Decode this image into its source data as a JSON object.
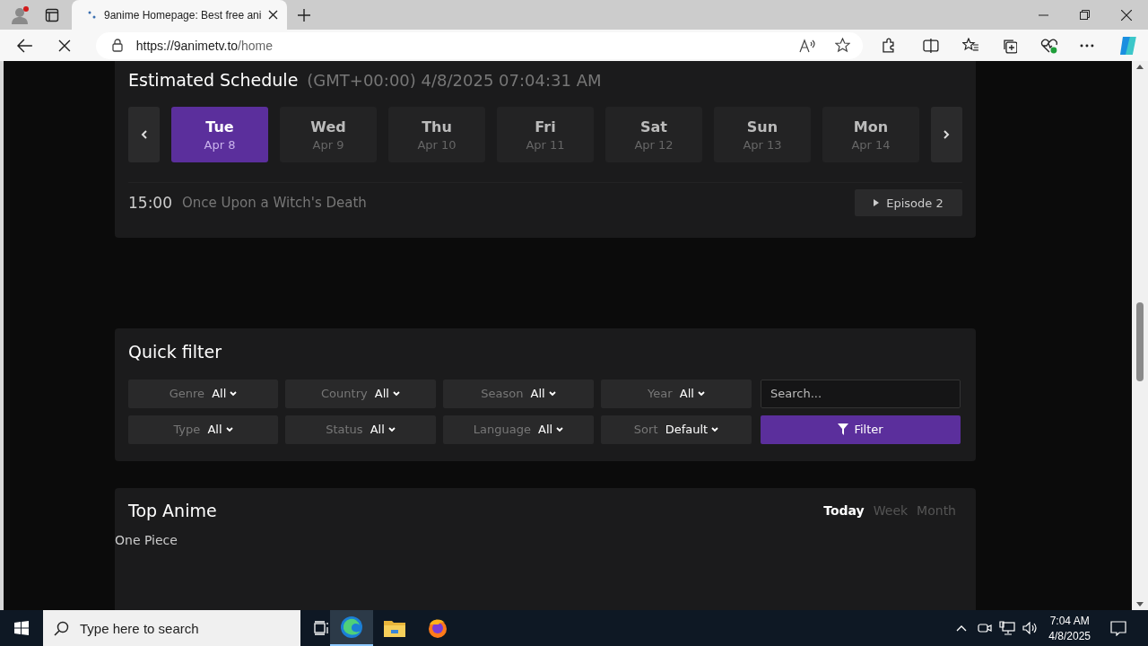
{
  "browser": {
    "tabs": [
      {
        "title": "9anime Homepage: Best free ani",
        "selected": true
      }
    ],
    "url_host": "https://9animetv.to",
    "url_path": "/home"
  },
  "schedule": {
    "title": "Estimated Schedule",
    "timestamp": "(GMT+00:00) 4/8/2025 07:04:31 AM",
    "days": [
      {
        "day": "Tue",
        "date": "Apr 8",
        "selected": true
      },
      {
        "day": "Wed",
        "date": "Apr 9",
        "selected": false
      },
      {
        "day": "Thu",
        "date": "Apr 10",
        "selected": false
      },
      {
        "day": "Fri",
        "date": "Apr 11",
        "selected": false
      },
      {
        "day": "Sat",
        "date": "Apr 12",
        "selected": false
      },
      {
        "day": "Sun",
        "date": "Apr 13",
        "selected": false
      },
      {
        "day": "Mon",
        "date": "Apr 14",
        "selected": false
      }
    ],
    "entries": [
      {
        "time": "15:00",
        "title": "Once Upon a Witch's Death",
        "episode": "Episode 2"
      }
    ]
  },
  "quick_filter": {
    "title": "Quick filter",
    "filters": [
      {
        "label": "Genre",
        "value": "All"
      },
      {
        "label": "Country",
        "value": "All"
      },
      {
        "label": "Season",
        "value": "All"
      },
      {
        "label": "Year",
        "value": "All"
      },
      {
        "label": "Type",
        "value": "All"
      },
      {
        "label": "Status",
        "value": "All"
      },
      {
        "label": "Language",
        "value": "All"
      },
      {
        "label": "Sort",
        "value": "Default"
      }
    ],
    "search_placeholder": "Search...",
    "button": "Filter"
  },
  "top_anime": {
    "title": "Top Anime",
    "periods": [
      {
        "label": "Today",
        "selected": true
      },
      {
        "label": "Week",
        "selected": false
      },
      {
        "label": "Month",
        "selected": false
      }
    ],
    "items": [
      {
        "alt": "One Piece"
      }
    ]
  },
  "taskbar": {
    "search_placeholder": "Type here to search",
    "time": "7:04 AM",
    "date": "4/8/2025"
  }
}
